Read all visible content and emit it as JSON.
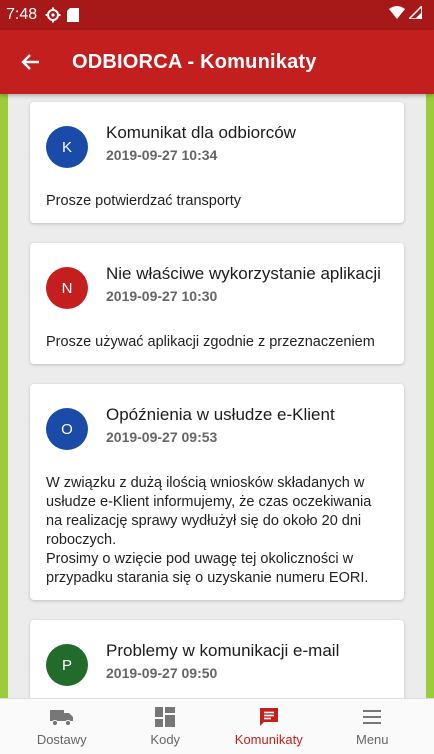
{
  "status_bar": {
    "time": "7:48"
  },
  "app_bar": {
    "title": "ODBIORCA - Komunikaty"
  },
  "messages": [
    {
      "initial": "K",
      "avatar_color": "#1a4ba8",
      "title": "Komunikat dla odbiorców",
      "date": "2019-09-27 10:34",
      "body": "Prosze potwierdzać transporty"
    },
    {
      "initial": "N",
      "avatar_color": "#c41f1f",
      "title": "Nie właściwe wykorzystanie aplikacji",
      "date": "2019-09-27 10:30",
      "body": "Prosze używać aplikacji zgodnie z przeznaczeniem"
    },
    {
      "initial": "O",
      "avatar_color": "#1a4ba8",
      "title": "Opóźnienia w usłudze e-Klient",
      "date": "2019-09-27 09:53",
      "body": "W związku z dużą ilością wniosków składanych w usłudze e-Klient informujemy, że czas oczekiwania na realizację sprawy wydłużył się do około 20 dni roboczych.\nProsimy o wzięcie pod uwagę tej okoliczności w przypadku starania się o uzyskanie numeru EORI."
    },
    {
      "initial": "P",
      "avatar_color": "#236b2a",
      "title": "Problemy w komunikacji e-mail",
      "date": "2019-09-27 09:50",
      "body": ""
    }
  ],
  "bottom_nav": [
    {
      "label": "Dostawy",
      "icon": "truck-icon",
      "active": false
    },
    {
      "label": "Kody",
      "icon": "dashboard-icon",
      "active": false
    },
    {
      "label": "Komunikaty",
      "icon": "message-icon",
      "active": true
    },
    {
      "label": "Menu",
      "icon": "menu-icon",
      "active": false
    }
  ],
  "colors": {
    "primary": "#c41f1f",
    "status_bar": "#a71818",
    "accent_border": "#9ccc3c"
  }
}
